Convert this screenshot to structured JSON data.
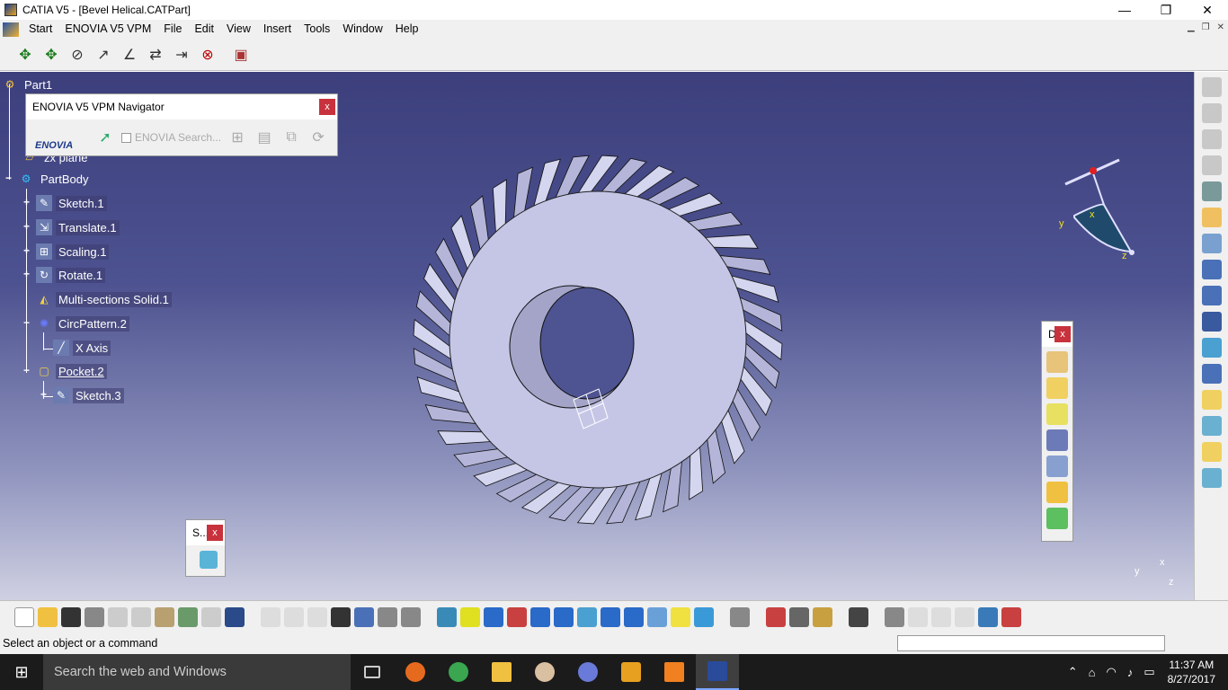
{
  "window": {
    "title": "CATIA V5 - [Bevel Helical.CATPart]",
    "minimize": "—",
    "maximize": "❐",
    "close": "✕"
  },
  "menu": [
    "Start",
    "ENOVIA V5 VPM",
    "File",
    "Edit",
    "View",
    "Insert",
    "Tools",
    "Window",
    "Help"
  ],
  "tree": {
    "root": "Part1",
    "plane": "zx plane",
    "body": "PartBody",
    "items": [
      "Sketch.1",
      "Translate.1",
      "Scaling.1",
      "Rotate.1",
      "Multi-sections Solid.1",
      "CircPattern.2",
      "X Axis",
      "Pocket.2",
      "Sketch.3"
    ]
  },
  "enovia": {
    "title": "ENOVIA V5 VPM Navigator",
    "close": "x",
    "logo": "ENOVIA",
    "search": "ENOVIA Search..."
  },
  "float_d": {
    "title": "D",
    "close": "x"
  },
  "float_s": {
    "title": "S...",
    "close": "x"
  },
  "compass": {
    "x": "x",
    "y": "y",
    "z": "z"
  },
  "mini_axis": {
    "y": "y",
    "x": "x",
    "z": "z"
  },
  "status": {
    "message": "Select an object or a command"
  },
  "taskbar": {
    "search": "Search the web and Windows",
    "time": "11:37 AM",
    "date": "8/27/2017"
  },
  "colors": {
    "viewport_top": "#3c3f7c",
    "viewport_bottom": "#cfd0e2",
    "gear": "#c5c6e6"
  }
}
